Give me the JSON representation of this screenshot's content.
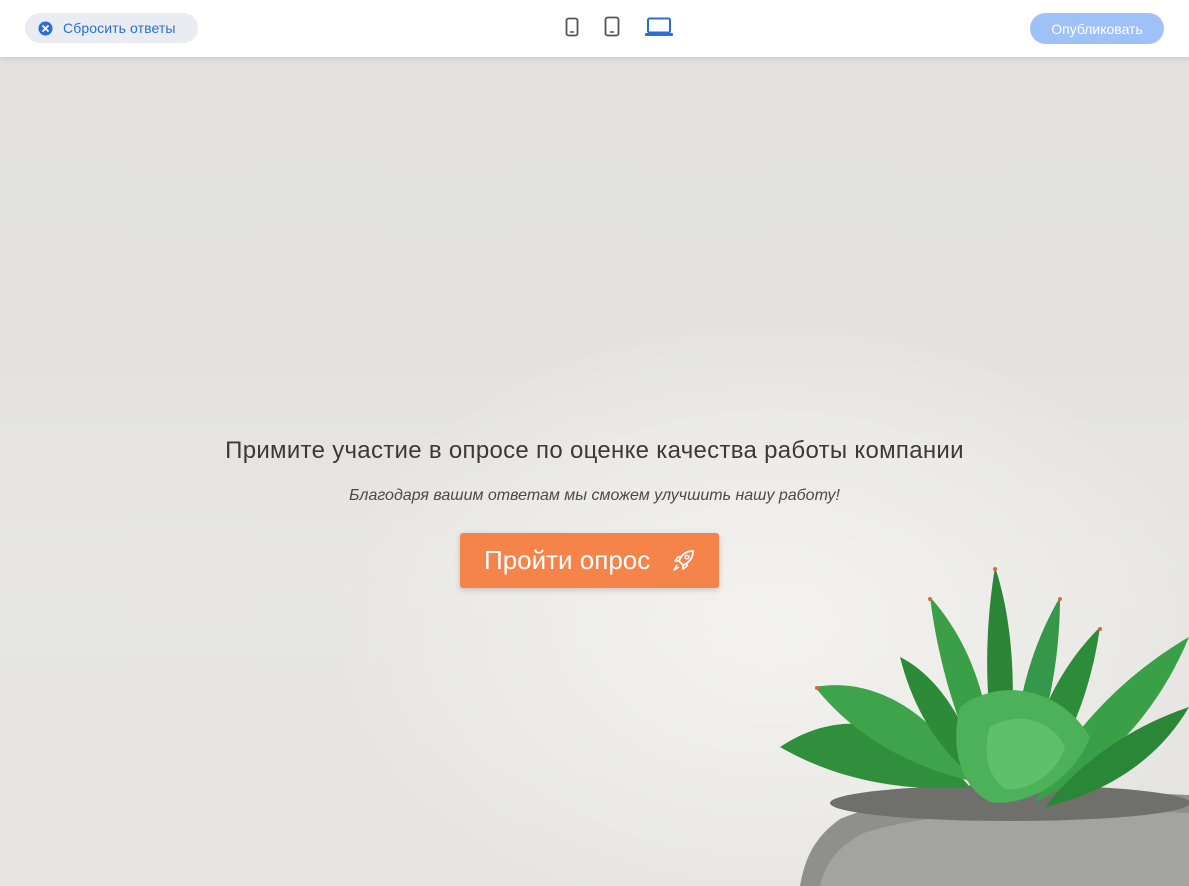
{
  "toolbar": {
    "reset_label": "Сбросить ответы",
    "publish_label": "Опубликовать",
    "devices": [
      {
        "name": "phone",
        "icon": "phone-icon"
      },
      {
        "name": "tablet",
        "icon": "tablet-icon"
      },
      {
        "name": "desktop",
        "icon": "laptop-icon",
        "active": true
      }
    ]
  },
  "survey": {
    "title": "Примите участие в опросе по оценке качества работы компании",
    "subtitle": "Благодаря вашим ответам мы сможем улучшить нашу работу!",
    "start_label": "Пройти опрос",
    "start_icon": "rocket-icon"
  },
  "colors": {
    "accent_blue": "#2a6fd6",
    "publish_bg": "#9ec2f7",
    "start_button": "#f5844a",
    "background": "#e3e2e0"
  }
}
